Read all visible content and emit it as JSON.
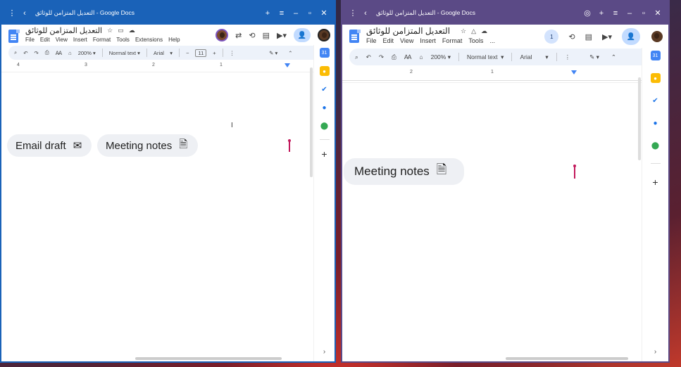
{
  "left": {
    "window_title": "التعديل المتزامن للوثائق - Google Docs",
    "doc_title": "التعديل المتزامن للوثائق",
    "menus": [
      "File",
      "Edit",
      "View",
      "Insert",
      "Format",
      "Tools",
      "Extensions",
      "Help"
    ],
    "zoom": "200%",
    "style": "Normal text",
    "font": "Arial",
    "font_size": "11",
    "ruler_labels": [
      "4",
      "3",
      "2",
      "1"
    ],
    "chips": [
      {
        "label": "Email draft",
        "icon": "email-draft-icon"
      },
      {
        "label": "Meeting notes",
        "icon": "document-icon"
      }
    ]
  },
  "right": {
    "window_title": "التعديل المتزامن للوثائق - Google Docs",
    "doc_title": "التعديل المتزامن للوثائق",
    "menus": [
      "File",
      "Edit",
      "View",
      "Insert",
      "Format",
      "Tools",
      "..."
    ],
    "zoom": "200%",
    "style": "Normal text",
    "font": "Arial",
    "collaborator_count": "1",
    "ruler_labels": [
      "2",
      "1"
    ],
    "chips": [
      {
        "label": "Meeting notes",
        "icon": "document-icon"
      }
    ]
  },
  "colors": {
    "left_frame": "#1a62b8",
    "right_frame": "#5b4a86",
    "chip_bg": "#eef0f4",
    "collab_cursor": "#c2185b"
  }
}
